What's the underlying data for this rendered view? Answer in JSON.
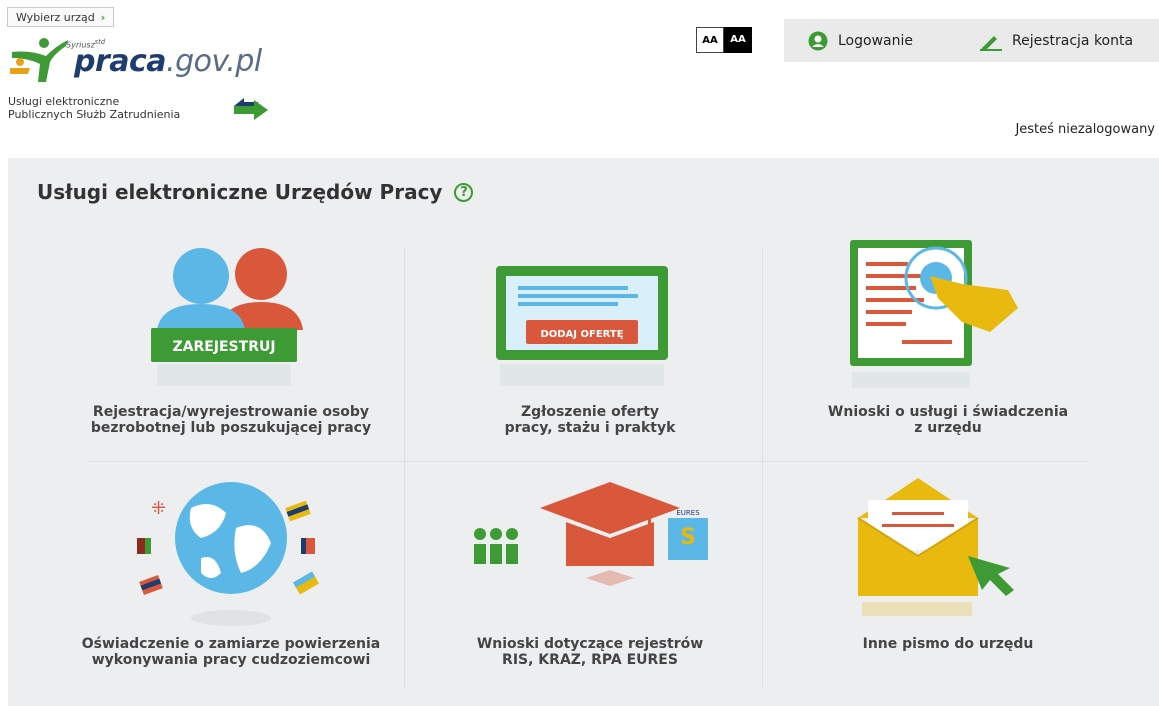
{
  "header": {
    "office_button": "Wybierz urząd",
    "office_chevron": "›",
    "logo_superscript": "Syriusz",
    "logo_std": "std",
    "logo_praca": "praca",
    "logo_gov": ".gov.pl",
    "subtitle_line1": "Usługi elektroniczne",
    "subtitle_line2": "Publicznych Służb Zatrudnienia",
    "font_small": "AA",
    "font_large": "AA",
    "login_label": "Logowanie",
    "register_label": "Rejestracja konta",
    "login_status": "Jesteś niezalogowany"
  },
  "main": {
    "title": "Usługi elektroniczne Urzędów Pracy",
    "help": "?",
    "tiles": [
      {
        "icon": "people-register-icon",
        "badge": "ZAREJESTRUJ",
        "line1": "Rejestracja/wyrejestrowanie osoby",
        "line2": "bezrobotnej lub poszukującej pracy"
      },
      {
        "icon": "job-offer-icon",
        "badge": "DODAJ OFERTĘ",
        "line1": "Zgłoszenie oferty",
        "line2": "pracy, stażu i praktyk"
      },
      {
        "icon": "document-touch-icon",
        "line1": "Wnioski o usługi i świadczenia",
        "line2": "z urzędu"
      },
      {
        "icon": "globe-flags-icon",
        "line1": "Oświadczenie o zamiarze powierzenia",
        "line2": "wykonywania pracy cudzoziemcowi"
      },
      {
        "icon": "graduation-cap-icon",
        "badge": "EURES",
        "line1": "Wnioski dotyczące rejestrów",
        "line2": "RIS, KRAZ, RPA EURES"
      },
      {
        "icon": "envelope-icon",
        "line1": "Inne pismo do urzędu",
        "line2": ""
      }
    ]
  },
  "colors": {
    "green": "#3d9a34",
    "navy": "#1e3c6e",
    "orange": "#d9583b",
    "yellow": "#e8b90f",
    "blue": "#5bb7e6"
  }
}
